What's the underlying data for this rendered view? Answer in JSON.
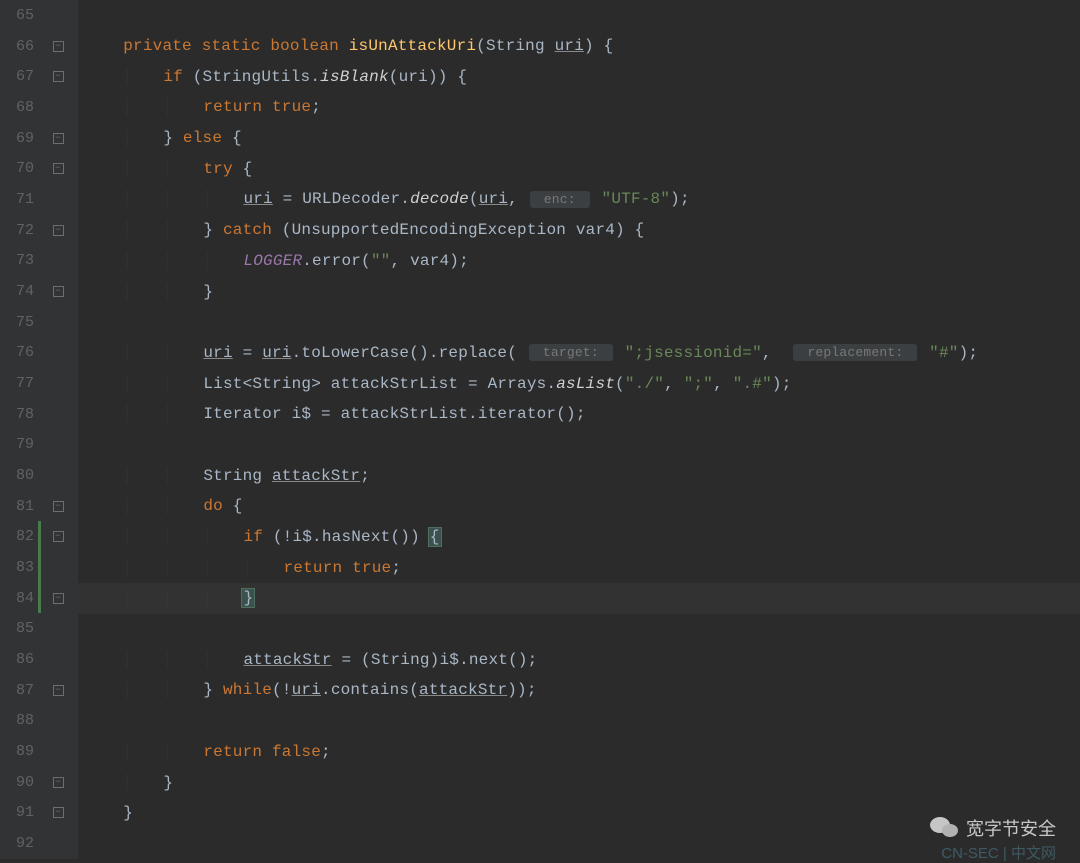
{
  "lineStart": 65,
  "highlightedLine": 84,
  "changeMarks": [
    82,
    83,
    84
  ],
  "foldIcons": {
    "66": "minus",
    "67": "minus",
    "69": "minus",
    "70": "minus",
    "72": "minus",
    "74": "minus",
    "81": "minus",
    "82": "minus",
    "84": "minus",
    "87": "minus",
    "90": "minus",
    "91": "minus"
  },
  "watermark": {
    "main": "宽字节安全",
    "sub": "CN-SEC | 中文网"
  },
  "code": [
    {
      "n": 65,
      "tokens": []
    },
    {
      "n": 66,
      "tokens": [
        {
          "t": "    "
        },
        {
          "t": "private",
          "c": "kw"
        },
        {
          "t": " "
        },
        {
          "t": "static",
          "c": "kw"
        },
        {
          "t": " "
        },
        {
          "t": "boolean",
          "c": "kw"
        },
        {
          "t": " "
        },
        {
          "t": "isUnAttackUri",
          "c": "method-decl"
        },
        {
          "t": "(String "
        },
        {
          "t": "uri",
          "c": "param"
        },
        {
          "t": ") {"
        }
      ]
    },
    {
      "n": 67,
      "tokens": [
        {
          "t": "        "
        },
        {
          "t": "if",
          "c": "kw"
        },
        {
          "t": " (StringUtils."
        },
        {
          "t": "isBlank",
          "c": "method-static"
        },
        {
          "t": "(uri)) {"
        }
      ]
    },
    {
      "n": 68,
      "tokens": [
        {
          "t": "            "
        },
        {
          "t": "return true",
          "c": "kw"
        },
        {
          "t": ";"
        }
      ]
    },
    {
      "n": 69,
      "tokens": [
        {
          "t": "        } "
        },
        {
          "t": "else",
          "c": "kw"
        },
        {
          "t": " {"
        }
      ]
    },
    {
      "n": 70,
      "tokens": [
        {
          "t": "            "
        },
        {
          "t": "try",
          "c": "kw"
        },
        {
          "t": " {"
        }
      ]
    },
    {
      "n": 71,
      "tokens": [
        {
          "t": "                "
        },
        {
          "t": "uri",
          "c": "local"
        },
        {
          "t": " = URLDecoder."
        },
        {
          "t": "decode",
          "c": "method-static"
        },
        {
          "t": "("
        },
        {
          "t": "uri",
          "c": "local"
        },
        {
          "t": ", "
        },
        {
          "t": " enc: ",
          "c": "hint-box"
        },
        {
          "t": " "
        },
        {
          "t": "\"UTF-8\"",
          "c": "str"
        },
        {
          "t": ");"
        }
      ]
    },
    {
      "n": 72,
      "tokens": [
        {
          "t": "            } "
        },
        {
          "t": "catch",
          "c": "kw"
        },
        {
          "t": " (UnsupportedEncodingException var4) {"
        }
      ]
    },
    {
      "n": 73,
      "tokens": [
        {
          "t": "                "
        },
        {
          "t": "LOGGER",
          "c": "field-static"
        },
        {
          "t": ".error("
        },
        {
          "t": "\"\"",
          "c": "str"
        },
        {
          "t": ", var4);"
        }
      ]
    },
    {
      "n": 74,
      "tokens": [
        {
          "t": "            }"
        }
      ]
    },
    {
      "n": 75,
      "tokens": []
    },
    {
      "n": 76,
      "tokens": [
        {
          "t": "            "
        },
        {
          "t": "uri",
          "c": "local"
        },
        {
          "t": " = "
        },
        {
          "t": "uri",
          "c": "local"
        },
        {
          "t": ".toLowerCase().replace( "
        },
        {
          "t": " target: ",
          "c": "hint-box"
        },
        {
          "t": " "
        },
        {
          "t": "\";jsessionid=\"",
          "c": "str"
        },
        {
          "t": ",  "
        },
        {
          "t": " replacement: ",
          "c": "hint-box"
        },
        {
          "t": " "
        },
        {
          "t": "\"#\"",
          "c": "str"
        },
        {
          "t": ");"
        }
      ]
    },
    {
      "n": 77,
      "tokens": [
        {
          "t": "            List<String> attackStrList = Arrays."
        },
        {
          "t": "asList",
          "c": "method-static"
        },
        {
          "t": "("
        },
        {
          "t": "\"./\"",
          "c": "str"
        },
        {
          "t": ", "
        },
        {
          "t": "\";\"",
          "c": "str"
        },
        {
          "t": ", "
        },
        {
          "t": "\".#\"",
          "c": "str"
        },
        {
          "t": ");"
        }
      ]
    },
    {
      "n": 78,
      "tokens": [
        {
          "t": "            Iterator i$ = attackStrList.iterator();"
        }
      ]
    },
    {
      "n": 79,
      "tokens": []
    },
    {
      "n": 80,
      "tokens": [
        {
          "t": "            String "
        },
        {
          "t": "attackStr",
          "c": "local"
        },
        {
          "t": ";"
        }
      ]
    },
    {
      "n": 81,
      "tokens": [
        {
          "t": "            "
        },
        {
          "t": "do",
          "c": "kw"
        },
        {
          "t": " {"
        }
      ]
    },
    {
      "n": 82,
      "tokens": [
        {
          "t": "                "
        },
        {
          "t": "if",
          "c": "kw"
        },
        {
          "t": " (!i$.hasNext()) "
        },
        {
          "t": "{",
          "c": "brace-hl"
        }
      ]
    },
    {
      "n": 83,
      "tokens": [
        {
          "t": "                    "
        },
        {
          "t": "return true",
          "c": "kw"
        },
        {
          "t": ";"
        }
      ]
    },
    {
      "n": 84,
      "tokens": [
        {
          "t": "                "
        },
        {
          "t": "}",
          "c": "brace-hl"
        }
      ]
    },
    {
      "n": 85,
      "tokens": []
    },
    {
      "n": 86,
      "tokens": [
        {
          "t": "                "
        },
        {
          "t": "attackStr",
          "c": "local"
        },
        {
          "t": " = (String)i$.next();"
        }
      ]
    },
    {
      "n": 87,
      "tokens": [
        {
          "t": "            } "
        },
        {
          "t": "while",
          "c": "kw"
        },
        {
          "t": "(!"
        },
        {
          "t": "uri",
          "c": "local"
        },
        {
          "t": ".contains("
        },
        {
          "t": "attackStr",
          "c": "local"
        },
        {
          "t": "));"
        }
      ]
    },
    {
      "n": 88,
      "tokens": []
    },
    {
      "n": 89,
      "tokens": [
        {
          "t": "            "
        },
        {
          "t": "return false",
          "c": "kw"
        },
        {
          "t": ";"
        }
      ]
    },
    {
      "n": 90,
      "tokens": [
        {
          "t": "        }"
        }
      ]
    },
    {
      "n": 91,
      "tokens": [
        {
          "t": "    }"
        }
      ]
    },
    {
      "n": 92,
      "tokens": []
    }
  ]
}
